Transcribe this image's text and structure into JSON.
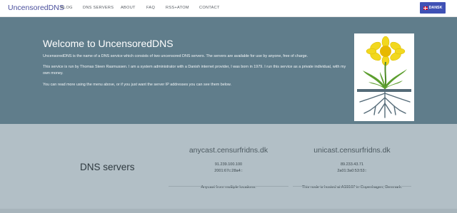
{
  "nav": {
    "brand": "UncensoredDNS",
    "items": [
      "BLOG",
      "DNS SERVERS",
      "ABOUT",
      "FAQ",
      "RSS+ATOM",
      "CONTACT"
    ],
    "language_button": "DANSK"
  },
  "hero": {
    "title": "Welcome to UncensoredDNS",
    "paragraphs": [
      "UncensoredDNS is the name of a DNS service which consists of two uncensored DNS servers. The servers are available for use by anyone, free of charge.",
      "This service is run by Thomas Steen Rasmussen. I am a system administrator with a Danish internet provider, I was born in 1979. I run this service as a private individual, with my own money.",
      "You can read more using the menu above, or if you just want the server IP addresses you can see them below."
    ]
  },
  "servers": {
    "title": "DNS servers",
    "list": [
      {
        "host": "anycast.censurfridns.dk",
        "ipv4": "91.239.100.100",
        "ipv6": "2001:67c:28a4::",
        "note": "Anycast from multiple locations."
      },
      {
        "host": "unicast.censurfridns.dk",
        "ipv4": "89.233.43.71",
        "ipv6": "2a01:3a0:53:53::",
        "note": "This node is hosted at AS9167 in Copenhagen, Denmark."
      }
    ]
  },
  "colors": {
    "brand": "#4a4f9c",
    "hero_bg": "#607d8b",
    "servers_bg": "#b2bfc6",
    "button": "#3f51b5"
  },
  "icons": {
    "language_flag": "danish-flag-icon",
    "logo": "dandelion-logo"
  }
}
